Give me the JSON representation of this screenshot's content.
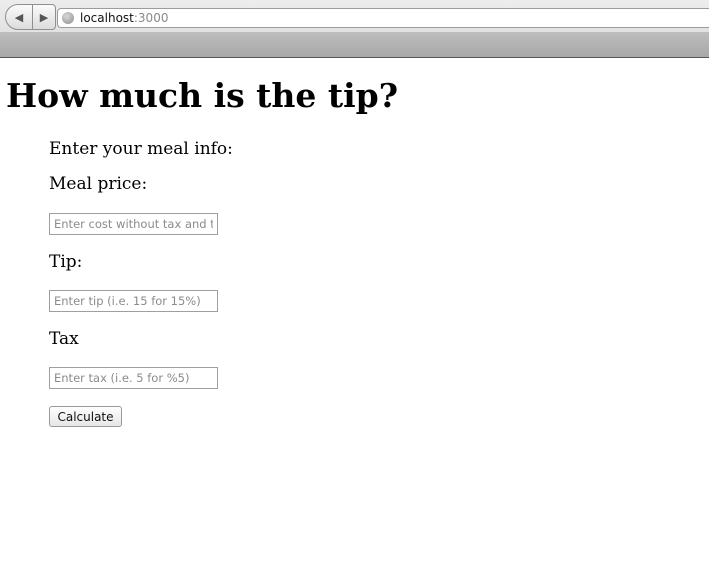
{
  "browser": {
    "url_host": "localhost",
    "url_port": ":3000",
    "back_glyph": "◀",
    "forward_glyph": "▶"
  },
  "page": {
    "title": "How much is the tip?",
    "intro": "Enter your meal info:",
    "meal_price": {
      "label": "Meal price:",
      "placeholder": "Enter cost without tax and tip",
      "value": ""
    },
    "tip": {
      "label": "Tip:",
      "placeholder": "Enter tip (i.e. 15 for 15%)",
      "value": ""
    },
    "tax": {
      "label": "Tax",
      "placeholder": "Enter tax (i.e. 5 for %5)",
      "value": ""
    },
    "calculate_label": "Calculate"
  }
}
